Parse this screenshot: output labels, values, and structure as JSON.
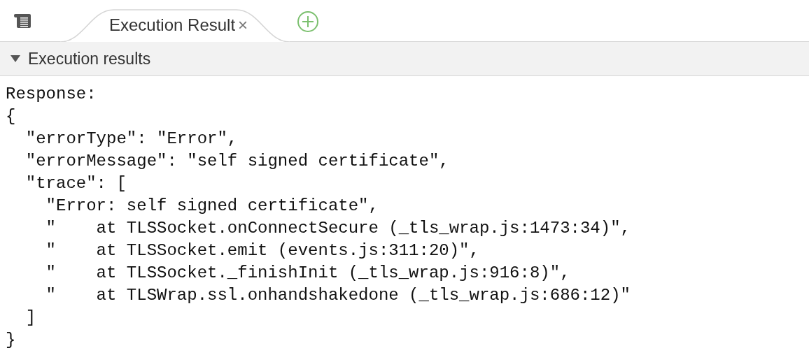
{
  "tabs": [
    {
      "label": "Execution Result",
      "close": "×",
      "selected": true
    }
  ],
  "section": {
    "title": "Execution results",
    "expanded": true
  },
  "output_lines": [
    "Response:",
    "{",
    "  \"errorType\": \"Error\",",
    "  \"errorMessage\": \"self signed certificate\",",
    "  \"trace\": [",
    "    \"Error: self signed certificate\",",
    "    \"    at TLSSocket.onConnectSecure (_tls_wrap.js:1473:34)\",",
    "    \"    at TLSSocket.emit (events.js:311:20)\",",
    "    \"    at TLSSocket._finishInit (_tls_wrap.js:916:8)\",",
    "    \"    at TLSWrap.ssl.onhandshakedone (_tls_wrap.js:686:12)\"",
    "  ]",
    "}"
  ]
}
